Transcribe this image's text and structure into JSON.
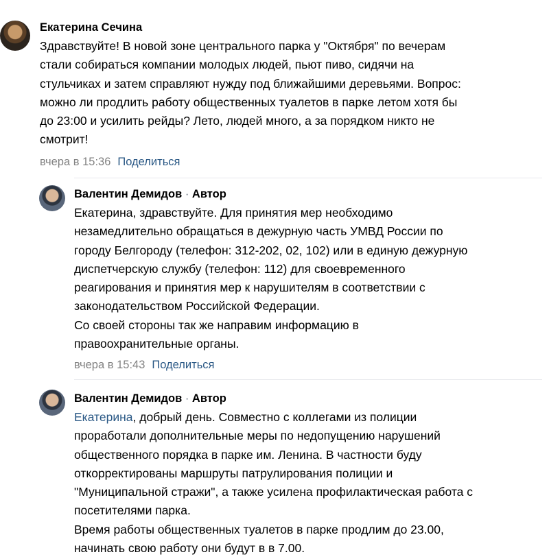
{
  "comments": [
    {
      "author": "Екатерина Сечина",
      "lines": [
        "Здравствуйте! В новой зоне центрального парка у \"Октября\" по вечерам",
        "стали собираться компании молодых людей, пьют пиво, сидячи на",
        "стульчиках и затем справляют нужду под ближайшими деревьями. Вопрос:",
        "можно ли продлить работу общественных туалетов в парке летом хотя бы",
        "до 23:00 и усилить рейды? Лето, людей много, а за порядком никто не",
        "смотрит!"
      ],
      "date": "вчера в 15:36",
      "share": "Поделиться"
    }
  ],
  "replies": [
    {
      "author": "Валентин Демидов",
      "sep": " · ",
      "role": "Автор",
      "lines": [
        "Екатерина, здравствуйте. Для принятия мер необходимо",
        "незамедлительно обращаться в дежурную часть УМВД России по",
        "городу Белгороду (телефон: 312-202, 02, 102) или в единую дежурную",
        "диспетчерскую службу (телефон: 112) для своевременного",
        "реагирования и принятия мер к нарушителям в соответствии с",
        "законодательством Российской Федерации.",
        "Со своей стороны так же направим информацию в",
        "правоохранительные органы."
      ],
      "date": "вчера в 15:43",
      "share": "Поделиться"
    },
    {
      "author": "Валентин Демидов",
      "sep": " · ",
      "role": "Автор",
      "mention": "Екатерина",
      "first_line_rest": ", добрый день. Совместно с коллегами из полиции",
      "lines": [
        "проработали дополнительные меры по недопущению нарушений",
        "общественного порядка в парке им. Ленина. В частности буду",
        "откорректированы маршруты патрулирования полиции и",
        "\"Муниципальной стражи\", а также усилена профилактическая работа с",
        "посетителями парка.",
        "Время работы общественных туалетов в парке продлим до 23.00,",
        "начинать свою работу они будут в в 7.00."
      ]
    }
  ]
}
